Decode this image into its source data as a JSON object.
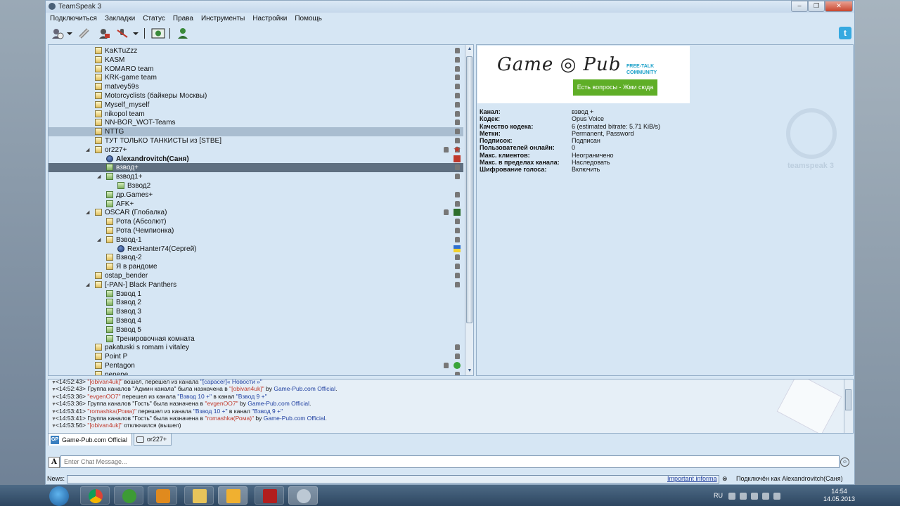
{
  "window": {
    "title": "TeamSpeak 3",
    "controls": [
      "‒",
      "❐",
      "✕"
    ]
  },
  "menu": [
    "Подключиться",
    "Закладки",
    "Статус",
    "Права",
    "Инструменты",
    "Настройки",
    "Помощь"
  ],
  "tree": [
    {
      "label": "KaKTuZzz",
      "indent": 1,
      "icon": "channel",
      "lock": true
    },
    {
      "label": "KASM",
      "indent": 1,
      "icon": "channel",
      "lock": true
    },
    {
      "label": "KOMARO team",
      "indent": 1,
      "icon": "channel",
      "lock": true
    },
    {
      "label": "KRK-game team",
      "indent": 1,
      "icon": "channel",
      "lock": true
    },
    {
      "label": "matvey59s",
      "indent": 1,
      "icon": "channel",
      "lock": true
    },
    {
      "label": "Motorcyclists (байкеры Москвы)",
      "indent": 1,
      "icon": "channel",
      "lock": true
    },
    {
      "label": "Myself_myself",
      "indent": 1,
      "icon": "channel",
      "lock": true
    },
    {
      "label": "nikopol team",
      "indent": 1,
      "icon": "channel",
      "lock": true
    },
    {
      "label": "NN-BOR_WOT-Teams",
      "indent": 1,
      "icon": "channel",
      "lock": true
    },
    {
      "label": "NTTG",
      "indent": 1,
      "icon": "channel",
      "lock": true,
      "state": "hover"
    },
    {
      "label": "ТУТ ТОЛЬКО ТАНКИСТЫ из [STBE]",
      "indent": 1,
      "icon": "channel",
      "lock": true
    },
    {
      "label": "or227+",
      "indent": 1,
      "icon": "channel",
      "expand": "◢",
      "lock": true,
      "lock2": true,
      "badge": "star"
    },
    {
      "label": "Alexandrovitch(Саня)",
      "indent": 2,
      "icon": "client",
      "bold": true,
      "lock": true,
      "badge": "flag"
    },
    {
      "label": "взвод+",
      "indent": 2,
      "icon": "green",
      "lock": true,
      "state": "selected"
    },
    {
      "label": "взвод1+",
      "indent": 2,
      "icon": "green",
      "expand": "◢",
      "lock": true
    },
    {
      "label": "Взвод2",
      "indent": 3,
      "icon": "green"
    },
    {
      "label": "др.Games+",
      "indent": 2,
      "icon": "green",
      "lock": true
    },
    {
      "label": "AFK+",
      "indent": 2,
      "icon": "green",
      "lock": true
    },
    {
      "label": "OSCAR (Глобалка)",
      "indent": 1,
      "icon": "channel",
      "expand": "◢",
      "lock": true,
      "lock2": true,
      "badge": "tank"
    },
    {
      "label": "Рота (Абсолют)",
      "indent": 2,
      "icon": "channel",
      "lock": true
    },
    {
      "label": "Рота (Чемпионка)",
      "indent": 2,
      "icon": "channel",
      "lock": true
    },
    {
      "label": "Взвод-1",
      "indent": 2,
      "icon": "channel",
      "expand": "◢",
      "lock": true
    },
    {
      "label": "RexHanter74(Сергей)",
      "indent": 3,
      "icon": "client",
      "badge": "ua"
    },
    {
      "label": "Взвод-2",
      "indent": 2,
      "icon": "channel",
      "lock": true
    },
    {
      "label": "Я в рандоме",
      "indent": 2,
      "icon": "channel",
      "lock": true
    },
    {
      "label": "ostap_bender",
      "indent": 1,
      "icon": "channel",
      "lock": true
    },
    {
      "label": "[-PAN-] Black Panthers",
      "indent": 1,
      "icon": "channel",
      "expand": "◢",
      "lock": true
    },
    {
      "label": "Взвод 1",
      "indent": 2,
      "icon": "green"
    },
    {
      "label": "Взвод 2",
      "indent": 2,
      "icon": "green"
    },
    {
      "label": "Взвод 3",
      "indent": 2,
      "icon": "green"
    },
    {
      "label": "Взвод 4",
      "indent": 2,
      "icon": "green"
    },
    {
      "label": "Взвод 5",
      "indent": 2,
      "icon": "green"
    },
    {
      "label": "Тренировочная комната",
      "indent": 2,
      "icon": "green"
    },
    {
      "label": "pakatuski s romam i vitaley",
      "indent": 1,
      "icon": "channel",
      "lock": true
    },
    {
      "label": "Point P",
      "indent": 1,
      "icon": "channel",
      "lock": true
    },
    {
      "label": "Pentagon",
      "indent": 1,
      "icon": "channel",
      "lock": true,
      "lock2": true,
      "badge": "check"
    },
    {
      "label": "penepe",
      "indent": 1,
      "icon": "channel",
      "lock": true
    }
  ],
  "banner": {
    "logo": "Game ◎ Pub",
    "tagline": "FREE-TALK COMMUNITY",
    "button": "Есть вопросы - Жми сюда"
  },
  "info": [
    {
      "k": "Канал:",
      "v": "взвод +"
    },
    {
      "k": "Кодек:",
      "v": "Opus Voice"
    },
    {
      "k": "Качество кодека:",
      "v": "6 (estimated bitrate: 5.71 KiB/s)"
    },
    {
      "k": "Метки:",
      "v": "Permanent, Password"
    },
    {
      "k": "Подписок:",
      "v": "Подписан"
    },
    {
      "k": "Пользователей онлайн:",
      "v": "0"
    },
    {
      "k": "Макс. клиентов:",
      "v": "Неограничено"
    },
    {
      "k": "Макс. в пределах канала:",
      "v": "Наследовать"
    },
    {
      "k": "Шифрование голоса:",
      "v": "Включить"
    }
  ],
  "ts_logo": "teamspeak 3",
  "log": [
    [
      {
        "t": "<14:52:43> ",
        "c": "t"
      },
      {
        "t": "\"[obivan4uk]\"",
        "c": "r"
      },
      {
        "t": " вошел, перешел из канала ",
        "c": "t"
      },
      {
        "t": "\"[capacer]« Новости »\"",
        "c": "b"
      }
    ],
    [
      {
        "t": "<14:52:43> ",
        "c": "t"
      },
      {
        "t": "Группа каналов \"Админ канала\" была назначена в ",
        "c": "t"
      },
      {
        "t": "\"[obivan4uk]\"",
        "c": "r"
      },
      {
        "t": " by ",
        "c": "t"
      },
      {
        "t": "Game-Pub.com Official",
        "c": "b"
      },
      {
        "t": ".",
        "c": "t"
      }
    ],
    [
      {
        "t": "<14:53:36> ",
        "c": "t"
      },
      {
        "t": "\"evgenOO7\"",
        "c": "r"
      },
      {
        "t": " перешел из канала ",
        "c": "t"
      },
      {
        "t": "\"Взвод 10 +\"",
        "c": "b"
      },
      {
        "t": " в канал ",
        "c": "t"
      },
      {
        "t": "\"Взвод 9 +\"",
        "c": "b"
      }
    ],
    [
      {
        "t": "<14:53:36> ",
        "c": "t"
      },
      {
        "t": "Группа каналов \"Гость\" была назначена в ",
        "c": "t"
      },
      {
        "t": "\"evgenOO7\"",
        "c": "r"
      },
      {
        "t": " by ",
        "c": "t"
      },
      {
        "t": "Game-Pub.com Official",
        "c": "b"
      },
      {
        "t": ".",
        "c": "t"
      }
    ],
    [
      {
        "t": "<14:53:41> ",
        "c": "t"
      },
      {
        "t": "\"romashka(Рома)\"",
        "c": "r"
      },
      {
        "t": " перешел из канала ",
        "c": "t"
      },
      {
        "t": "\"Взвод 10 +\"",
        "c": "b"
      },
      {
        "t": " в канал ",
        "c": "t"
      },
      {
        "t": "\"Взвод 9 +\"",
        "c": "b"
      }
    ],
    [
      {
        "t": "<14:53:41> ",
        "c": "t"
      },
      {
        "t": "Группа каналов \"Гость\" была назначена в ",
        "c": "t"
      },
      {
        "t": "\"romashka(Рома)\"",
        "c": "r"
      },
      {
        "t": " by ",
        "c": "t"
      },
      {
        "t": "Game-Pub.com Official",
        "c": "b"
      },
      {
        "t": ".",
        "c": "t"
      }
    ],
    [
      {
        "t": "<14:53:56> ",
        "c": "t"
      },
      {
        "t": "\"[obivan4uk]\"",
        "c": "r"
      },
      {
        "t": " отключился (вышел)",
        "c": "t"
      }
    ]
  ],
  "tabs": [
    {
      "label": "Game-Pub.com Official",
      "icon": "GP"
    },
    {
      "label": "or227+"
    }
  ],
  "chat": {
    "placeholder": "Enter Chat Message..."
  },
  "status": {
    "news_label": "News:",
    "important": "Important informa",
    "close": "⊗",
    "connected": "Подключён как Alexandrovitch(Саня)"
  },
  "tray": {
    "lang": "RU",
    "time": "14:54",
    "date": "14.05.2013"
  }
}
